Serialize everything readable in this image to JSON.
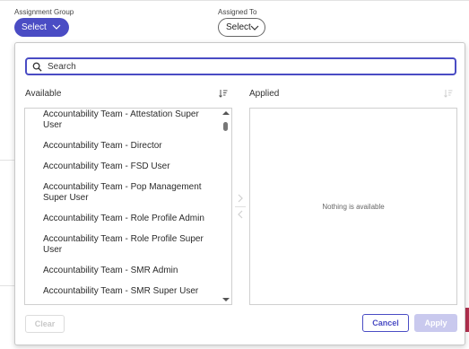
{
  "filters": {
    "assignment_group_label": "Assignment Group",
    "assignment_group_value": "Select",
    "assigned_to_label": "Assigned To",
    "assigned_to_value": "Select"
  },
  "picker": {
    "search_placeholder": "Search",
    "search_value": "",
    "available_title": "Available",
    "applied_title": "Applied",
    "available_items": [
      "Accountability Team - Attestation Super User",
      "Accountability Team - Director",
      "Accountability Team - FSD User",
      "Accountability Team - Pop Management Super User",
      "Accountability Team - Role Profile Admin",
      "Accountability Team - Role Profile Super User",
      "Accountability Team - SMR Admin",
      "Accountability Team - SMR Super User"
    ],
    "empty_applied_text": "Nothing is available",
    "clear_label": "Clear",
    "cancel_label": "Cancel",
    "apply_label": "Apply"
  },
  "colors": {
    "accent": "#4a4cc4",
    "disabled_apply": "#c9c9ee"
  },
  "icons": [
    "chevron-down-icon",
    "search-icon",
    "sort-icon",
    "move-right-icon",
    "move-left-icon",
    "scroll-up-icon",
    "scroll-down-icon"
  ]
}
